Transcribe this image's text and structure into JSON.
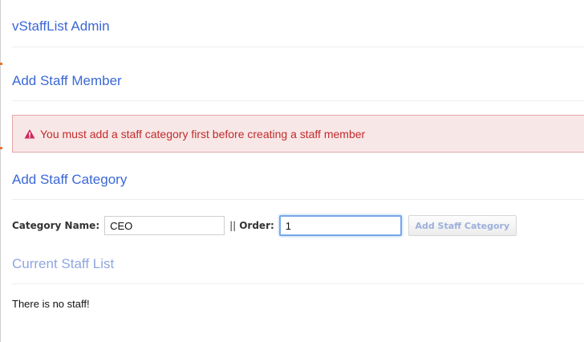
{
  "admin": {
    "title": "vStaffList Admin"
  },
  "add_staff_member": {
    "heading": "Add Staff Member",
    "alert": {
      "icon": "warning-icon",
      "message": "You must add a staff category first before creating a staff member",
      "color": "#c22b2b"
    }
  },
  "add_staff_category": {
    "heading": "Add Staff Category",
    "category_name_label": "Category Name:",
    "category_name_value": "CEO",
    "separator": "||",
    "order_label": "Order:",
    "order_value": "1",
    "submit_label": "Add Staff Category"
  },
  "current_staff": {
    "heading": "Current Staff List",
    "empty_message": "There is no staff!"
  },
  "colors": {
    "heading": "#3b68d6",
    "alert_background": "#f8e7e7",
    "alert_border": "#e4a6a6"
  }
}
